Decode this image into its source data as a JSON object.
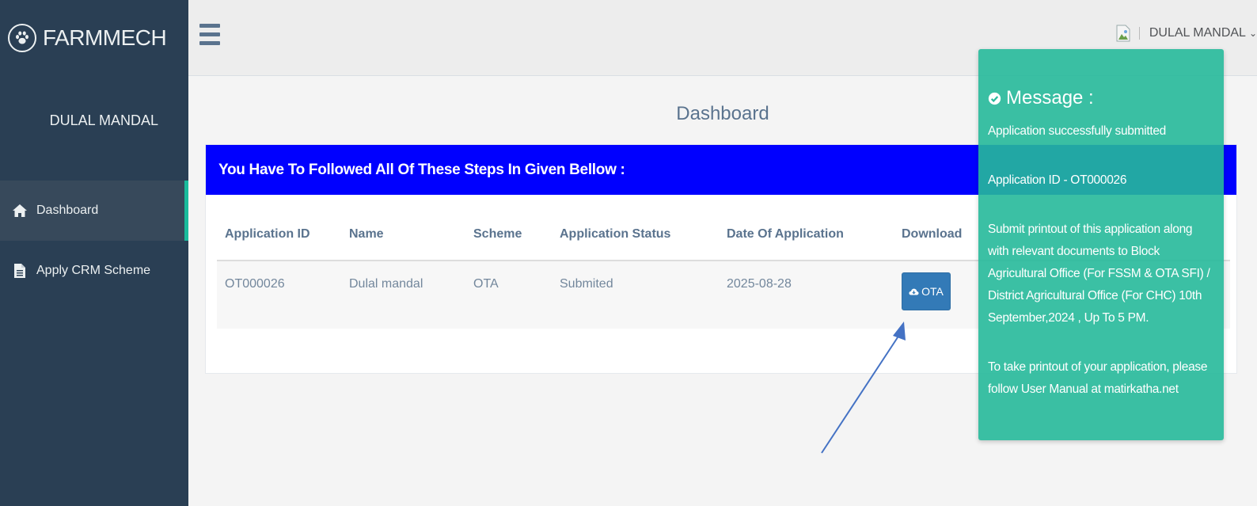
{
  "sidebar": {
    "brand": "FARMMECH",
    "profile_name": "DULAL MANDAL",
    "items": [
      {
        "label": "Dashboard",
        "icon": "home-icon",
        "active": true
      },
      {
        "label": "Apply CRM Scheme",
        "icon": "file-icon",
        "active": false
      }
    ]
  },
  "header": {
    "user_name": "DULAL MANDAL",
    "caret": "⌄"
  },
  "main": {
    "page_title": "Dashboard",
    "panel_header": "You Have To Followed All Of These Steps In Given Bellow :",
    "table": {
      "columns": [
        "Application ID",
        "Name",
        "Scheme",
        "Application Status",
        "Date Of Application",
        "Download"
      ],
      "rows": [
        {
          "id": "OT000026",
          "name": "Dulal mandal",
          "scheme": "OTA",
          "status": "Submited",
          "date": "2025-08-28",
          "download_label": "OTA"
        }
      ]
    }
  },
  "toast": {
    "title": "Message :",
    "line1": "Application successfully submitted",
    "line2": "Application ID - OT000026",
    "line3": "Submit printout of this application along with relevant documents to Block Agricultural Office (For FSSM & OTA SFI) / District Agricultural Office (For CHC) 10th September,2024 , Up To 5 PM.",
    "line4": "To take printout of your application, please follow User Manual at matirkatha.net"
  },
  "colors": {
    "sidebar_bg": "#2a3f54",
    "panel_header_bg": "#0000ff",
    "toast_bg": "#26b99a",
    "button_bg": "#337ab7",
    "arrow": "#4472c4"
  }
}
